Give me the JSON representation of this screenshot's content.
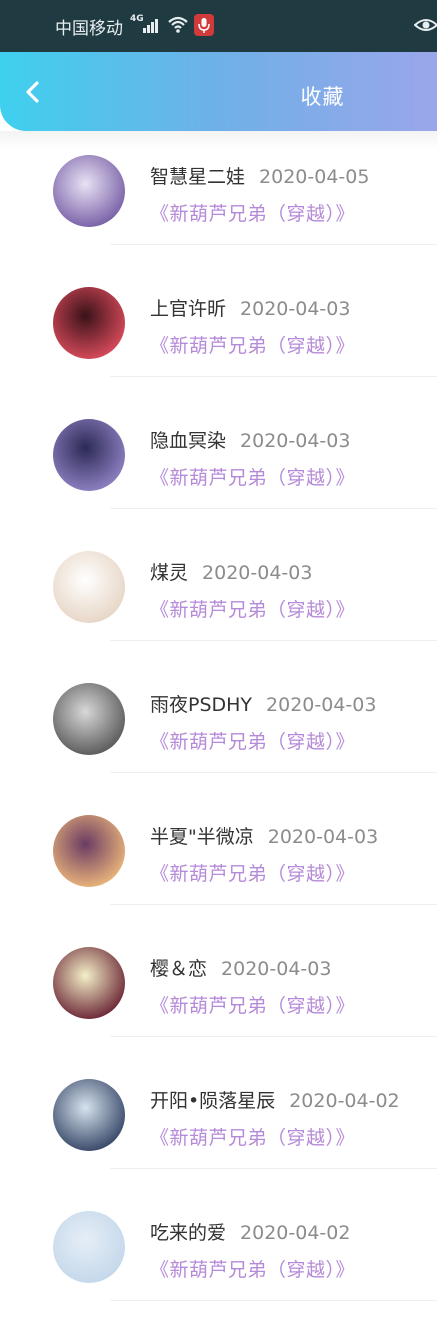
{
  "status_bar": {
    "carrier": "中国移动",
    "network": "4G"
  },
  "header": {
    "title": "收藏",
    "gradient": [
      "#3fd0ee",
      "#9aa6ea"
    ]
  },
  "accent_color": "#b58ad8",
  "items": [
    {
      "name": "智慧星二娃",
      "date": "2020-04-05",
      "work": "《新葫芦兄弟（穿越）》",
      "avatar_color": [
        "#e9e2f4",
        "#7a62a8"
      ]
    },
    {
      "name": "上官许昕",
      "date": "2020-04-03",
      "work": "《新葫芦兄弟（穿越）》",
      "avatar_color": [
        "#3a1218",
        "#d54a5a"
      ]
    },
    {
      "name": "隐血冥染",
      "date": "2020-04-03",
      "work": "《新葫芦兄弟（穿越）》",
      "avatar_color": [
        "#2b2a55",
        "#8d7fc0"
      ]
    },
    {
      "name": "煤灵",
      "date": "2020-04-03",
      "work": "《新葫芦兄弟（穿越）》",
      "avatar_color": [
        "#ffffff",
        "#e7d6c6"
      ]
    },
    {
      "name": "雨夜PSDHY",
      "date": "2020-04-03",
      "work": "《新葫芦兄弟（穿越）》",
      "avatar_color": [
        "#d8d8d8",
        "#5c5c5c"
      ]
    },
    {
      "name": "半夏\"半微凉",
      "date": "2020-04-03",
      "work": "《新葫芦兄弟（穿越）》",
      "avatar_color": [
        "#6a3b63",
        "#e9b37a"
      ]
    },
    {
      "name": "樱＆恋",
      "date": "2020-04-03",
      "work": "《新葫芦兄弟（穿越）》",
      "avatar_color": [
        "#f3f0c8",
        "#6e2a38"
      ]
    },
    {
      "name": "开阳•陨落星辰",
      "date": "2020-04-02",
      "work": "《新葫芦兄弟（穿越）》",
      "avatar_color": [
        "#d7e3ee",
        "#3a4a6a"
      ]
    },
    {
      "name": "吃来的爱",
      "date": "2020-04-02",
      "work": "《新葫芦兄弟（穿越）》",
      "avatar_color": [
        "#e5eef7",
        "#c5d8ea"
      ]
    }
  ]
}
